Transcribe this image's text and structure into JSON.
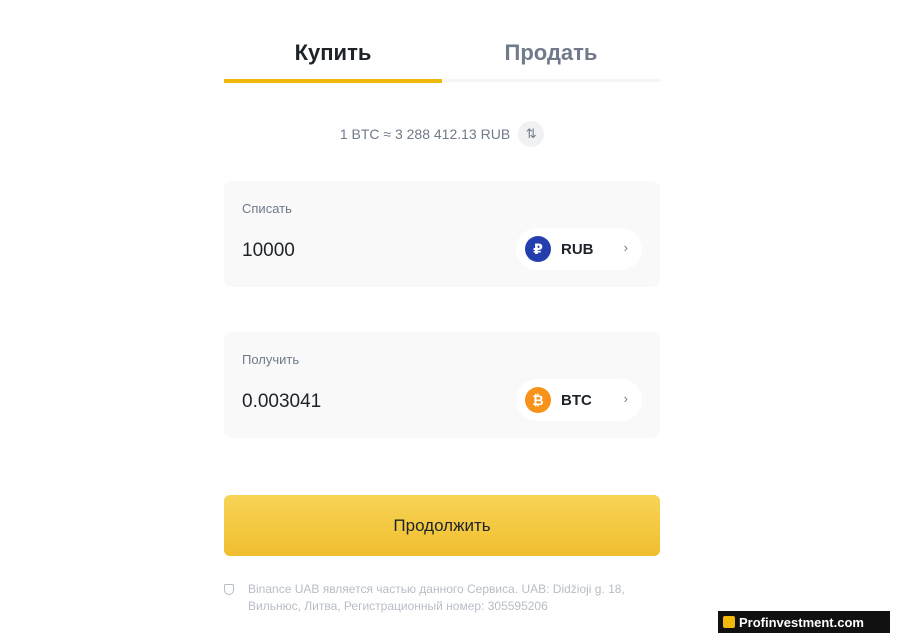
{
  "tabs": {
    "buy_label": "Купить",
    "sell_label": "Продать",
    "active": "buy"
  },
  "rate": {
    "text": "1 BTC ≈ 3 288 412.13 RUB",
    "swap_glyph": "⇅"
  },
  "spend": {
    "label": "Списать",
    "amount": "10000",
    "currency_code": "RUB",
    "currency_symbol": "₽",
    "icon": "ruble-coin-icon"
  },
  "receive": {
    "label": "Получить",
    "amount": "0.003041",
    "currency_code": "BTC",
    "currency_symbol": "₿",
    "icon": "bitcoin-coin-icon"
  },
  "continue_label": "Продолжить",
  "footnote": "Binance UAB является частью данного Сервиса. UAB: Didžioji g. 18, Вильнюс, Литва, Регистрационный номер: 305595206",
  "watermark": "Profinvestment.com",
  "colors": {
    "accent": "#f0b90b",
    "button": "#f0be2e",
    "rub_coin": "#253eae",
    "btc_coin": "#f7931a",
    "muted_text": "#707a8a"
  }
}
